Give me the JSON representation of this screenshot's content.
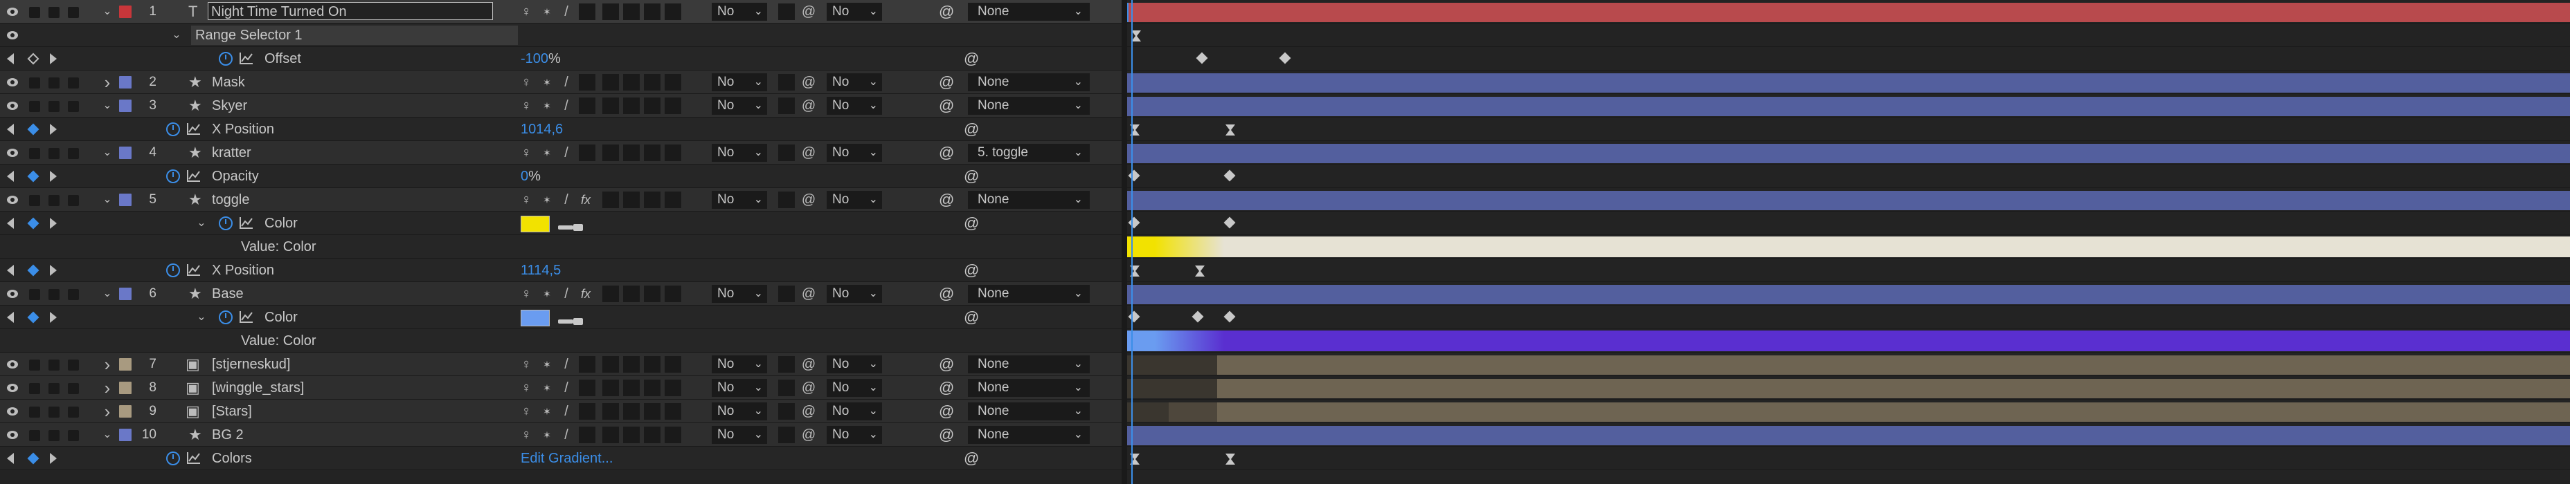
{
  "layers": [
    {
      "num": "1",
      "name": "Night Time Turned On",
      "type": "T",
      "label_color": "#c8363a",
      "editing": true,
      "parent": "None",
      "mode": "No",
      "trkmat": "No",
      "track_color": "#b84a4d",
      "selected": true
    },
    {
      "num": "2",
      "name": "Mask",
      "type": "star",
      "label_color": "#6a78c8",
      "parent": "None",
      "mode": "No",
      "trkmat": "No",
      "track_color": "#535f9e"
    },
    {
      "num": "3",
      "name": "Skyer",
      "type": "star",
      "label_color": "#6a78c8",
      "parent": "None",
      "mode": "No",
      "trkmat": "No",
      "track_color": "#535f9e"
    },
    {
      "num": "4",
      "name": "kratter",
      "type": "star",
      "label_color": "#6a78c8",
      "parent": "5. toggle",
      "mode": "No",
      "trkmat": "No",
      "track_color": "#535f9e"
    },
    {
      "num": "5",
      "name": "toggle",
      "type": "star",
      "label_color": "#6a78c8",
      "parent": "None",
      "mode": "No",
      "trkmat": "No",
      "track_color": "#535f9e"
    },
    {
      "num": "6",
      "name": "Base",
      "type": "star",
      "label_color": "#6a78c8",
      "parent": "None",
      "mode": "No",
      "trkmat": "No",
      "track_color": "#535f9e"
    },
    {
      "num": "7",
      "name": "[stjerneskud]",
      "type": "precomp",
      "label_color": "#a89a80",
      "parent": "None",
      "mode": "No",
      "trkmat": "No",
      "track_color": "#6e6452"
    },
    {
      "num": "8",
      "name": "[winggle_stars]",
      "type": "precomp",
      "label_color": "#a89a80",
      "parent": "None",
      "mode": "No",
      "trkmat": "No",
      "track_color": "#6e6452"
    },
    {
      "num": "9",
      "name": "[Stars]",
      "type": "precomp",
      "label_color": "#a89a80",
      "parent": "None",
      "mode": "No",
      "trkmat": "No",
      "track_color": "#6e6452"
    },
    {
      "num": "10",
      "name": "BG 2",
      "type": "star",
      "label_color": "#6a78c8",
      "parent": "None",
      "mode": "No",
      "trkmat": "No",
      "track_color": "#535f9e"
    }
  ],
  "properties": {
    "range_selector": "Range Selector 1",
    "offset_label": "Offset",
    "offset_value": "-100",
    "offset_unit": "%",
    "xpos3_label": "X Position",
    "xpos3_value": "1014,6",
    "opacity_label": "Opacity",
    "opacity_value": "0",
    "opacity_unit": "%",
    "color5_label": "Color",
    "color5_swatch": "#f2e200",
    "value_color_label": "Value: Color",
    "xpos5_label": "X Position",
    "xpos5_value": "1114,5",
    "color6_label": "Color",
    "color6_swatch": "#6a9cf0",
    "value_color6_label": "Value: Color",
    "colors_label": "Colors",
    "colors_value": "Edit Gradient..."
  },
  "colors": {
    "accent": "#3b8ee8",
    "panel_bg": "#232323",
    "row_bg": "#2e2e2e",
    "value_color5_gradient_start": "#f2e200",
    "value_color5_gradient_end": "#e6e2d4",
    "value_color6_gradient_start": "#6a9cf0",
    "value_color6_gradient_end": "#5a2fd0"
  },
  "icons": {
    "visibility": "eye-icon",
    "stopwatch": "stopwatch-icon",
    "graph": "graph-icon",
    "shy": "shy-icon",
    "fx": "fx-icon",
    "motion_blur": "motion-blur-icon",
    "parent_pick": "pickwhip-icon"
  }
}
